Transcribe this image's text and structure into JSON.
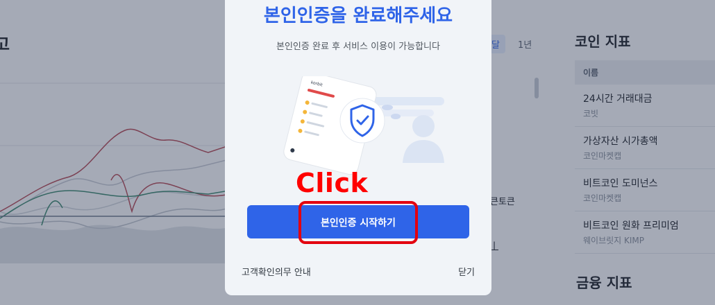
{
  "background": {
    "left_title": "고",
    "tabs": [
      "달",
      "1년"
    ],
    "right_snippet": "큰토큰",
    "right_link": "ㅣ",
    "coin_panel": {
      "title": "코인 지표",
      "header": "이름",
      "items": [
        {
          "name": "24시간 거래대금",
          "source": "코빗"
        },
        {
          "name": "가상자산 시가총액",
          "source": "코인마켓캡"
        },
        {
          "name": "비트코인 도미넌스",
          "source": "코인마켓캡"
        },
        {
          "name": "비트코인 원화 프리미엄",
          "source": "웨이브릿지 KIMP"
        }
      ]
    },
    "finance_title": "금융 지표"
  },
  "modal": {
    "title": "본인인증을 완료해주세요",
    "subtitle": "본인인증 완료 후 서비스 이용이 가능합니다",
    "annotation": "Click",
    "primary_button": "본인인증 시작하기",
    "footer_left": "고객확인의무 안내",
    "footer_right": "닫기",
    "phone_brand": "korbit"
  },
  "colors": {
    "accent": "#2f64e8",
    "annotation_red": "#ff0000",
    "overlay": "rgba(40,52,80,0.42)"
  },
  "icons": [
    "shield-check-icon",
    "user-silhouette-icon",
    "phone-illustration"
  ]
}
